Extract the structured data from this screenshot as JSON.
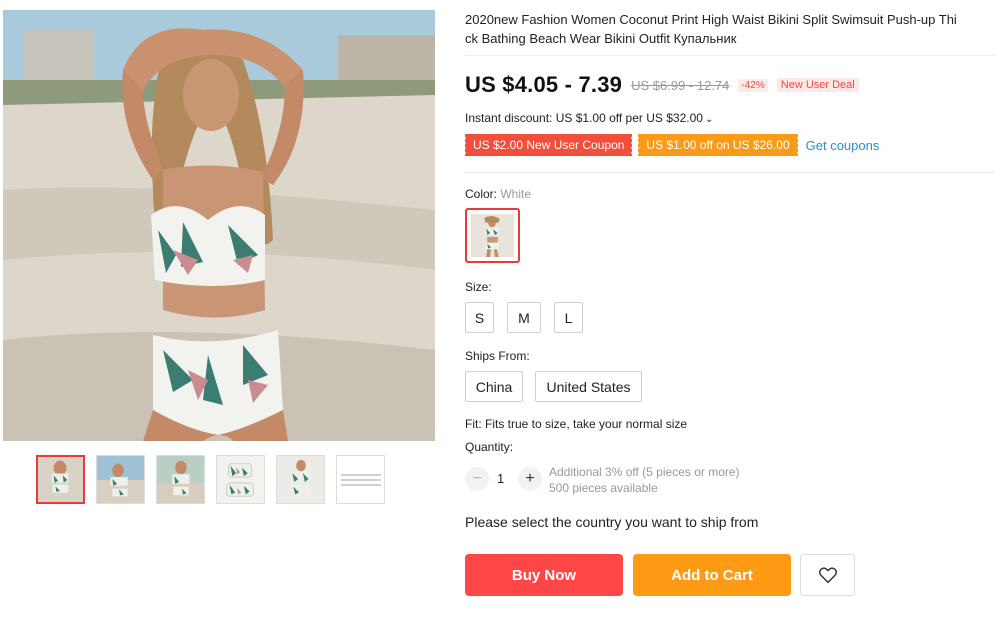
{
  "product": {
    "title_line1": "2020new Fashion Women Coconut Print High Waist Bikini Split Swimsuit Push-up Thi",
    "title_line2": "ck Bathing Beach Wear Bikini Outfit Купальник"
  },
  "price": {
    "current": "US $4.05 - 7.39",
    "original": "US $6.99 - 12.74",
    "discount": "-42%",
    "deal": "New User Deal"
  },
  "instant_discount": {
    "text": "Instant discount: US $1.00 off per US $32.00",
    "chevron_icon": "chevron-down-icon"
  },
  "coupons": {
    "new_user": "US $2.00 New User Coupon",
    "store": "US $1.00 off on US $26.00",
    "get_link": "Get coupons"
  },
  "color": {
    "label": "Color:",
    "selected": "White"
  },
  "size": {
    "label": "Size:",
    "options": [
      "S",
      "M",
      "L"
    ]
  },
  "ships_from": {
    "label": "Ships From:",
    "options": [
      "China",
      "United States"
    ]
  },
  "fit": "Fit: Fits true to size, take your normal size",
  "quantity": {
    "label": "Quantity:",
    "value": "1",
    "minus": "−",
    "plus": "+",
    "additional": "Additional 3% off (5 pieces or more)",
    "available": "500 pieces available"
  },
  "ship_note": "Please select the country you want to ship from",
  "actions": {
    "buy_now": "Buy Now",
    "add_to_cart": "Add to Cart",
    "wishlist_icon": "heart-icon"
  },
  "colors": {
    "primary_red": "#ff4747",
    "cart_orange": "#ff9a14",
    "link_blue": "#2a8fc9",
    "selected_border": "#e63b3b"
  }
}
